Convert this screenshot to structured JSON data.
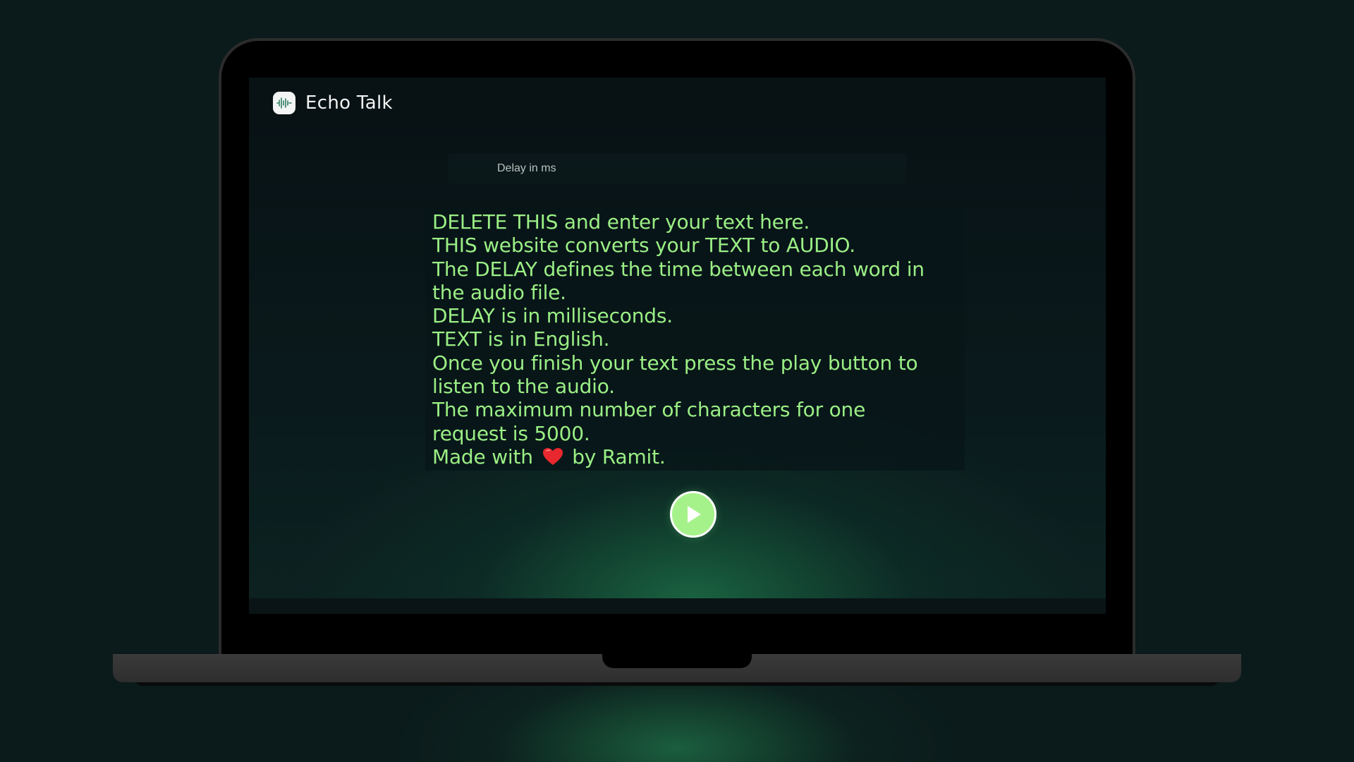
{
  "app": {
    "name": "Echo Talk",
    "logo_icon": "waveform-icon"
  },
  "delay_input": {
    "placeholder": "Delay in ms",
    "value": ""
  },
  "text_input": {
    "lines": [
      "DELETE THIS and enter your text here.",
      "THIS website converts your TEXT to AUDIO.",
      "The DELAY defines the time between each word in",
      "the audio file.",
      "DELAY is in milliseconds.",
      "TEXT is in English.",
      "Once you finish your text press the play button to",
      "listen to the audio.",
      "The maximum number of characters for one",
      "request is 5000."
    ],
    "last_line_prefix": "Made with",
    "last_line_icon": "heart-icon",
    "last_line_suffix": "by Ramit."
  },
  "play_button": {
    "icon": "play-icon"
  },
  "colors": {
    "accent": "#a6f28a",
    "text": "#9bef85",
    "background": "#0b1a1b"
  }
}
